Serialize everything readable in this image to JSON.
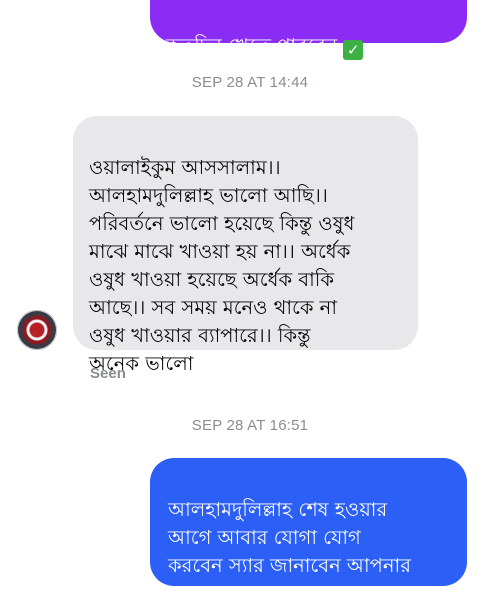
{
  "messages": {
    "outgoing_top": "কতদিন খেতে পারবেন",
    "incoming": "ওয়ালাইকুম আসসালাম।।\nআলহামদুলিল্লাহ ভালো আছি।।\nপরিবর্তনে ভালো হয়েছে কিন্তু ওষুধ\nমাঝে মাঝে খাওয়া হয় না।। অর্ধেক\nওষুধ খাওয়া হয়েছে অর্ধেক বাকি\nআছে।। সব সময় মনেও থাকে না\nওষুধ খাওয়ার ব্যাপারে।। কিন্তু\nঅনেক ভালো",
    "outgoing_bottom": "আলহামদুলিল্লাহ শেষ হওয়ার\nআগে আবার যোগা যোগ\nকরবেন স্যার জানাবেন আপনার\nঅবস্তান"
  },
  "check_emoji": "✓",
  "timestamps": {
    "first": "SEP 28 AT 14:44",
    "second": "SEP 28 AT 16:51"
  },
  "seen_label": "Seen",
  "colors": {
    "outgoing_top_bg": "#8b2cf5",
    "outgoing_bottom_bg": "#2b5ff5",
    "incoming_bg": "#e8e8ea",
    "meta_text": "#8a8d91"
  },
  "icons": {
    "avatar": "profile-avatar-icon",
    "check": "green-check-emoji-icon"
  }
}
